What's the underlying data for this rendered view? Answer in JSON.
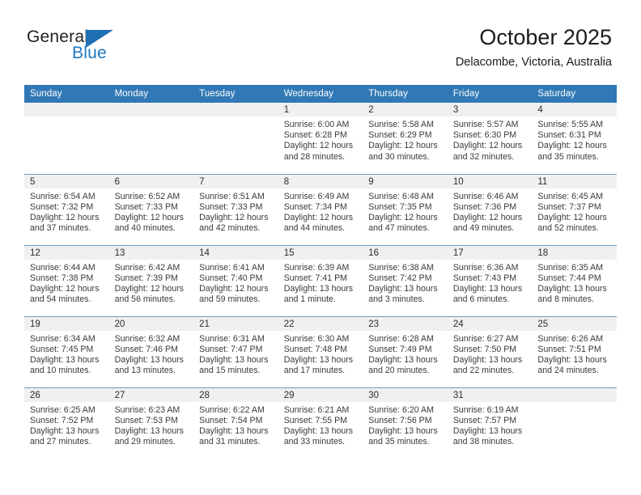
{
  "brand": {
    "name_top": "General",
    "name_bottom": "Blue",
    "triangle_color": "#1f6fb5",
    "blue_color": "#1f78c1"
  },
  "header": {
    "title": "October 2025",
    "subtitle": "Delacombe, Victoria, Australia",
    "header_bg": "#3178b6",
    "row_divider": "#6b9cc6",
    "daynum_bg": "#f0f0f0"
  },
  "calendar": {
    "weekday_headers": [
      "Sunday",
      "Monday",
      "Tuesday",
      "Wednesday",
      "Thursday",
      "Friday",
      "Saturday"
    ],
    "weeks": [
      [
        {
          "day": "",
          "lines": []
        },
        {
          "day": "",
          "lines": []
        },
        {
          "day": "",
          "lines": []
        },
        {
          "day": "1",
          "lines": [
            "Sunrise: 6:00 AM",
            "Sunset: 6:28 PM",
            "Daylight: 12 hours",
            "and 28 minutes."
          ]
        },
        {
          "day": "2",
          "lines": [
            "Sunrise: 5:58 AM",
            "Sunset: 6:29 PM",
            "Daylight: 12 hours",
            "and 30 minutes."
          ]
        },
        {
          "day": "3",
          "lines": [
            "Sunrise: 5:57 AM",
            "Sunset: 6:30 PM",
            "Daylight: 12 hours",
            "and 32 minutes."
          ]
        },
        {
          "day": "4",
          "lines": [
            "Sunrise: 5:55 AM",
            "Sunset: 6:31 PM",
            "Daylight: 12 hours",
            "and 35 minutes."
          ]
        }
      ],
      [
        {
          "day": "5",
          "lines": [
            "Sunrise: 6:54 AM",
            "Sunset: 7:32 PM",
            "Daylight: 12 hours",
            "and 37 minutes."
          ]
        },
        {
          "day": "6",
          "lines": [
            "Sunrise: 6:52 AM",
            "Sunset: 7:33 PM",
            "Daylight: 12 hours",
            "and 40 minutes."
          ]
        },
        {
          "day": "7",
          "lines": [
            "Sunrise: 6:51 AM",
            "Sunset: 7:33 PM",
            "Daylight: 12 hours",
            "and 42 minutes."
          ]
        },
        {
          "day": "8",
          "lines": [
            "Sunrise: 6:49 AM",
            "Sunset: 7:34 PM",
            "Daylight: 12 hours",
            "and 44 minutes."
          ]
        },
        {
          "day": "9",
          "lines": [
            "Sunrise: 6:48 AM",
            "Sunset: 7:35 PM",
            "Daylight: 12 hours",
            "and 47 minutes."
          ]
        },
        {
          "day": "10",
          "lines": [
            "Sunrise: 6:46 AM",
            "Sunset: 7:36 PM",
            "Daylight: 12 hours",
            "and 49 minutes."
          ]
        },
        {
          "day": "11",
          "lines": [
            "Sunrise: 6:45 AM",
            "Sunset: 7:37 PM",
            "Daylight: 12 hours",
            "and 52 minutes."
          ]
        }
      ],
      [
        {
          "day": "12",
          "lines": [
            "Sunrise: 6:44 AM",
            "Sunset: 7:38 PM",
            "Daylight: 12 hours",
            "and 54 minutes."
          ]
        },
        {
          "day": "13",
          "lines": [
            "Sunrise: 6:42 AM",
            "Sunset: 7:39 PM",
            "Daylight: 12 hours",
            "and 56 minutes."
          ]
        },
        {
          "day": "14",
          "lines": [
            "Sunrise: 6:41 AM",
            "Sunset: 7:40 PM",
            "Daylight: 12 hours",
            "and 59 minutes."
          ]
        },
        {
          "day": "15",
          "lines": [
            "Sunrise: 6:39 AM",
            "Sunset: 7:41 PM",
            "Daylight: 13 hours",
            "and 1 minute."
          ]
        },
        {
          "day": "16",
          "lines": [
            "Sunrise: 6:38 AM",
            "Sunset: 7:42 PM",
            "Daylight: 13 hours",
            "and 3 minutes."
          ]
        },
        {
          "day": "17",
          "lines": [
            "Sunrise: 6:36 AM",
            "Sunset: 7:43 PM",
            "Daylight: 13 hours",
            "and 6 minutes."
          ]
        },
        {
          "day": "18",
          "lines": [
            "Sunrise: 6:35 AM",
            "Sunset: 7:44 PM",
            "Daylight: 13 hours",
            "and 8 minutes."
          ]
        }
      ],
      [
        {
          "day": "19",
          "lines": [
            "Sunrise: 6:34 AM",
            "Sunset: 7:45 PM",
            "Daylight: 13 hours",
            "and 10 minutes."
          ]
        },
        {
          "day": "20",
          "lines": [
            "Sunrise: 6:32 AM",
            "Sunset: 7:46 PM",
            "Daylight: 13 hours",
            "and 13 minutes."
          ]
        },
        {
          "day": "21",
          "lines": [
            "Sunrise: 6:31 AM",
            "Sunset: 7:47 PM",
            "Daylight: 13 hours",
            "and 15 minutes."
          ]
        },
        {
          "day": "22",
          "lines": [
            "Sunrise: 6:30 AM",
            "Sunset: 7:48 PM",
            "Daylight: 13 hours",
            "and 17 minutes."
          ]
        },
        {
          "day": "23",
          "lines": [
            "Sunrise: 6:28 AM",
            "Sunset: 7:49 PM",
            "Daylight: 13 hours",
            "and 20 minutes."
          ]
        },
        {
          "day": "24",
          "lines": [
            "Sunrise: 6:27 AM",
            "Sunset: 7:50 PM",
            "Daylight: 13 hours",
            "and 22 minutes."
          ]
        },
        {
          "day": "25",
          "lines": [
            "Sunrise: 6:26 AM",
            "Sunset: 7:51 PM",
            "Daylight: 13 hours",
            "and 24 minutes."
          ]
        }
      ],
      [
        {
          "day": "26",
          "lines": [
            "Sunrise: 6:25 AM",
            "Sunset: 7:52 PM",
            "Daylight: 13 hours",
            "and 27 minutes."
          ]
        },
        {
          "day": "27",
          "lines": [
            "Sunrise: 6:23 AM",
            "Sunset: 7:53 PM",
            "Daylight: 13 hours",
            "and 29 minutes."
          ]
        },
        {
          "day": "28",
          "lines": [
            "Sunrise: 6:22 AM",
            "Sunset: 7:54 PM",
            "Daylight: 13 hours",
            "and 31 minutes."
          ]
        },
        {
          "day": "29",
          "lines": [
            "Sunrise: 6:21 AM",
            "Sunset: 7:55 PM",
            "Daylight: 13 hours",
            "and 33 minutes."
          ]
        },
        {
          "day": "30",
          "lines": [
            "Sunrise: 6:20 AM",
            "Sunset: 7:56 PM",
            "Daylight: 13 hours",
            "and 35 minutes."
          ]
        },
        {
          "day": "31",
          "lines": [
            "Sunrise: 6:19 AM",
            "Sunset: 7:57 PM",
            "Daylight: 13 hours",
            "and 38 minutes."
          ]
        },
        {
          "day": "",
          "lines": []
        }
      ]
    ]
  }
}
